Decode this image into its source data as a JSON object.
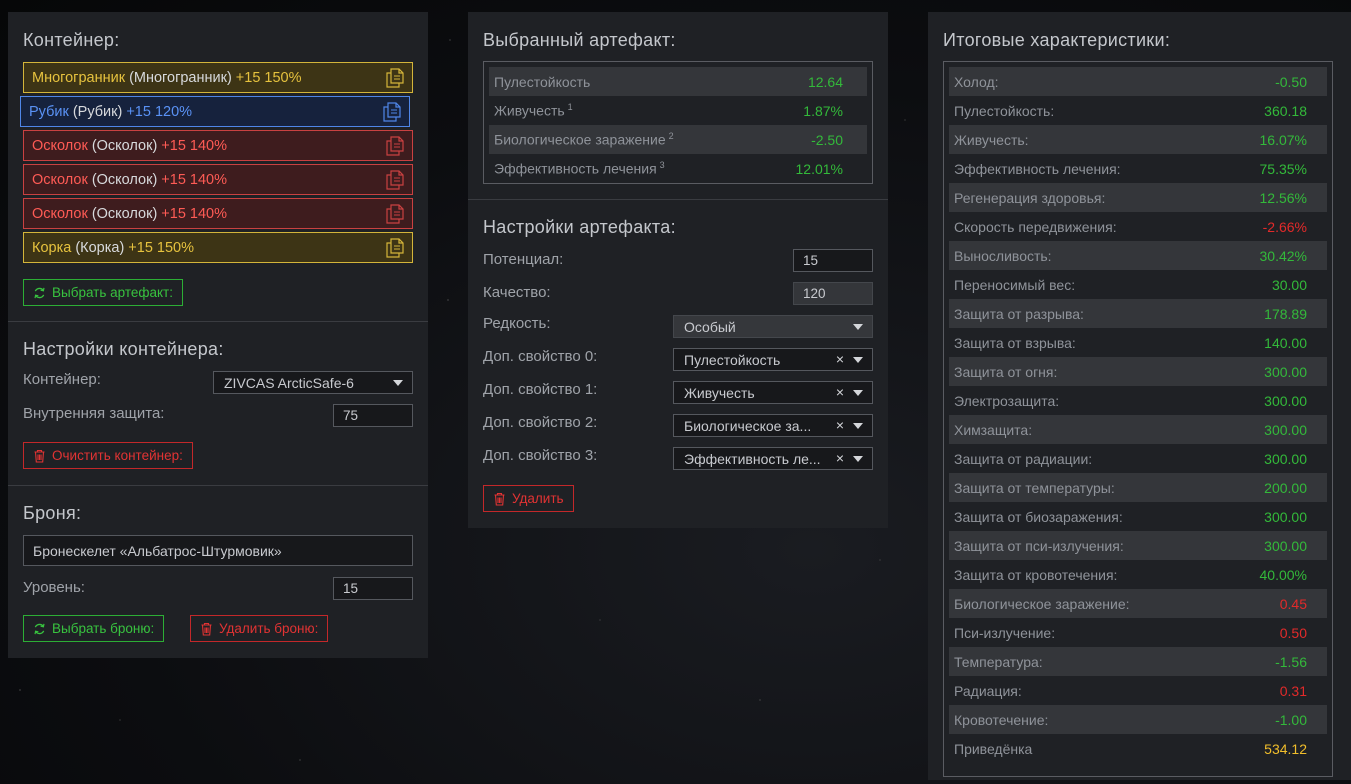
{
  "container": {
    "title": "Контейнер:",
    "items": [
      {
        "name": "Многогранник",
        "orig": "(Многогранник)",
        "tail": "+15 150%",
        "rarity": "gold"
      },
      {
        "name": "Рубик",
        "orig": "(Рубик)",
        "tail": "+15 120%",
        "rarity": "blue"
      },
      {
        "name": "Осколок",
        "orig": "(Осколок)",
        "tail": "+15 140%",
        "rarity": "red"
      },
      {
        "name": "Осколок",
        "orig": "(Осколок)",
        "tail": "+15 140%",
        "rarity": "red"
      },
      {
        "name": "Осколок",
        "orig": "(Осколок)",
        "tail": "+15 140%",
        "rarity": "red"
      },
      {
        "name": "Корка",
        "orig": "(Корка)",
        "tail": "+15 150%",
        "rarity": "gold"
      }
    ],
    "select_artifact_label": "Выбрать артефакт:",
    "settings_title": "Настройки контейнера:",
    "container_label": "Контейнер:",
    "container_value": "ZIVCAS ArcticSafe-6",
    "inner_protection_label": "Внутренняя защита:",
    "inner_protection_value": "75",
    "clear_label": "Очистить контейнер:"
  },
  "armor": {
    "title": "Броня:",
    "name": "Бронескелет «Альбатрос-Штурмовик»",
    "level_label": "Уровень:",
    "level_value": "15",
    "select_label": "Выбрать броню:",
    "delete_label": "Удалить броню:"
  },
  "artifact": {
    "title": "Выбранный артефакт:",
    "stats": [
      {
        "name": "Пулестойкость",
        "sup": "",
        "value": "12.64",
        "color": "green"
      },
      {
        "name": "Живучесть",
        "sup": "1",
        "value": "1.87%",
        "color": "green"
      },
      {
        "name": "Биологическое заражение",
        "sup": "2",
        "value": "-2.50",
        "color": "green"
      },
      {
        "name": "Эффективность лечения",
        "sup": "3",
        "value": "12.01%",
        "color": "green"
      }
    ],
    "settings_title": "Настройки артефакта:",
    "potential_label": "Потенциал:",
    "potential_value": "15",
    "quality_label": "Качество:",
    "quality_value": "120",
    "rarity_label": "Редкость:",
    "rarity_value": "Особый",
    "extra": [
      {
        "label": "Доп. свойство 0:",
        "value": "Пулестойкость"
      },
      {
        "label": "Доп. свойство 1:",
        "value": "Живучесть"
      },
      {
        "label": "Доп. свойство 2:",
        "value": "Биологическое за..."
      },
      {
        "label": "Доп. свойство 3:",
        "value": "Эффективность ле..."
      }
    ],
    "delete_label": "Удалить"
  },
  "totals": {
    "title": "Итоговые характеристики:",
    "stats": [
      {
        "name": "Холод:",
        "value": "-0.50",
        "color": "green"
      },
      {
        "name": "Пулестойкость:",
        "value": "360.18",
        "color": "green"
      },
      {
        "name": "Живучесть:",
        "value": "16.07%",
        "color": "green"
      },
      {
        "name": "Эффективность лечения:",
        "value": "75.35%",
        "color": "green"
      },
      {
        "name": "Регенерация здоровья:",
        "value": "12.56%",
        "color": "green"
      },
      {
        "name": "Скорость передвижения:",
        "value": "-2.66%",
        "color": "red"
      },
      {
        "name": "Выносливость:",
        "value": "30.42%",
        "color": "green"
      },
      {
        "name": "Переносимый вес:",
        "value": "30.00",
        "color": "green"
      },
      {
        "name": "Защита от разрыва:",
        "value": "178.89",
        "color": "green"
      },
      {
        "name": "Защита от взрыва:",
        "value": "140.00",
        "color": "green"
      },
      {
        "name": "Защита от огня:",
        "value": "300.00",
        "color": "green"
      },
      {
        "name": "Электрозащита:",
        "value": "300.00",
        "color": "green"
      },
      {
        "name": "Химзащита:",
        "value": "300.00",
        "color": "green"
      },
      {
        "name": "Защита от радиации:",
        "value": "300.00",
        "color": "green"
      },
      {
        "name": "Защита от температуры:",
        "value": "200.00",
        "color": "green"
      },
      {
        "name": "Защита от биозаражения:",
        "value": "300.00",
        "color": "green"
      },
      {
        "name": "Защита от пси-излучения:",
        "value": "300.00",
        "color": "green"
      },
      {
        "name": "Защита от кровотечения:",
        "value": "40.00%",
        "color": "green"
      },
      {
        "name": "Биологическое заражение:",
        "value": "0.45",
        "color": "red"
      },
      {
        "name": "Пси-излучение:",
        "value": "0.50",
        "color": "red"
      },
      {
        "name": "Температура:",
        "value": "-1.56",
        "color": "green"
      },
      {
        "name": "Радиация:",
        "value": "0.31",
        "color": "red"
      },
      {
        "name": "Кровотечение:",
        "value": "-1.00",
        "color": "green"
      },
      {
        "name": "Приведёнка",
        "value": "534.12",
        "color": "gold"
      }
    ]
  }
}
